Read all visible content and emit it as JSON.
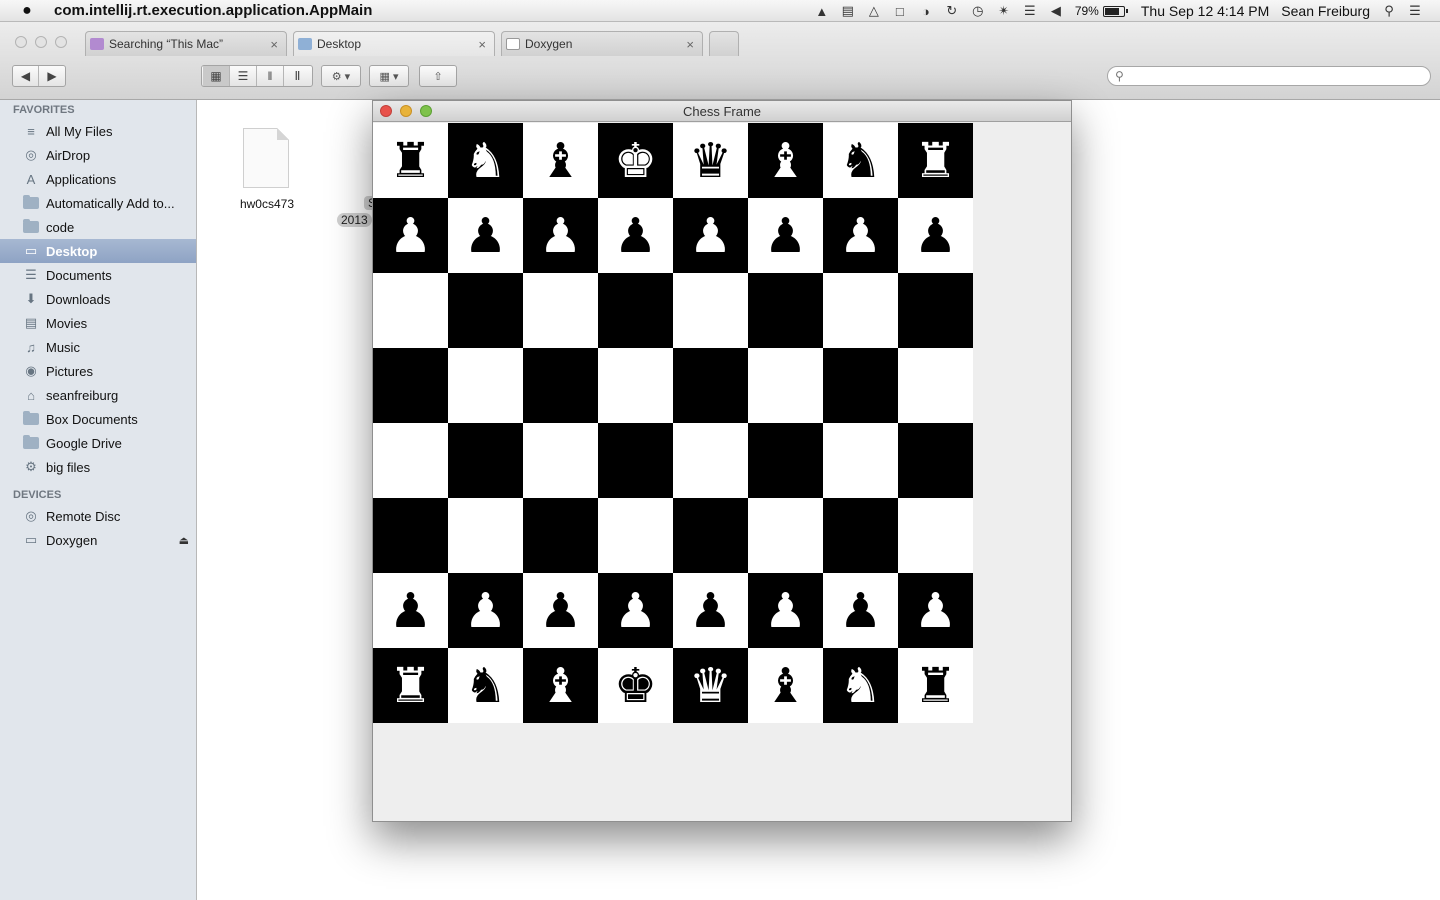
{
  "menubar": {
    "apple_icon": "apple-logo",
    "app_name": "com.intellij.rt.execution.application.AppMain",
    "status_icons": [
      "bowler-hat-icon",
      "scanner-icon",
      "drive-icon",
      "selection-icon",
      "cloud-icon",
      "sync-icon",
      "time-machine-icon",
      "bluetooth-icon",
      "wifi-icon",
      "volume-icon"
    ],
    "battery": "79%",
    "battery_level": 0.79,
    "clock": "Thu Sep 12  4:14 PM",
    "user": "Sean Freiburg",
    "search_icon": "spotlight-icon",
    "list_icon": "notification-center-icon"
  },
  "finder": {
    "tabs": [
      {
        "label": "Searching “This Mac”",
        "close": "×"
      },
      {
        "label": "Desktop",
        "close": "×"
      },
      {
        "label": "Doxygen",
        "close": "×"
      }
    ],
    "back": "◀",
    "forward": "▶",
    "view_modes": [
      "▦",
      "☰",
      "‖",
      "Ⅱ"
    ],
    "action": "⚙ ▾",
    "arrange": "▦ ▾",
    "share": "⇧",
    "search_placeholder": ""
  },
  "sidebar": {
    "favorites_header": "FAVORITES",
    "favorites": [
      {
        "label": "All My Files",
        "icon": "all-files-icon",
        "glyph": "≡"
      },
      {
        "label": "AirDrop",
        "icon": "airdrop-icon",
        "glyph": "◎"
      },
      {
        "label": "Applications",
        "icon": "applications-icon",
        "glyph": "A"
      },
      {
        "label": "Automatically Add to...",
        "icon": "folder-icon",
        "glyph": ""
      },
      {
        "label": "code",
        "icon": "folder-icon",
        "glyph": ""
      },
      {
        "label": "Desktop",
        "icon": "desktop-icon",
        "glyph": "▭"
      },
      {
        "label": "Documents",
        "icon": "documents-icon",
        "glyph": "☰"
      },
      {
        "label": "Downloads",
        "icon": "downloads-icon",
        "glyph": "⬇"
      },
      {
        "label": "Movies",
        "icon": "movies-icon",
        "glyph": "▤"
      },
      {
        "label": "Music",
        "icon": "music-icon",
        "glyph": "♫"
      },
      {
        "label": "Pictures",
        "icon": "pictures-icon",
        "glyph": "◉"
      },
      {
        "label": "seanfreiburg",
        "icon": "home-icon",
        "glyph": "⌂"
      },
      {
        "label": "Box Documents",
        "icon": "folder-icon",
        "glyph": ""
      },
      {
        "label": "Google Drive",
        "icon": "folder-icon",
        "glyph": ""
      },
      {
        "label": "big files",
        "icon": "gear-icon",
        "glyph": "⚙"
      }
    ],
    "devices_header": "DEVICES",
    "devices": [
      {
        "label": "Remote Disc",
        "icon": "remote-disc-icon",
        "glyph": "◎"
      },
      {
        "label": "Doxygen",
        "icon": "disk-image-icon",
        "glyph": "▭"
      }
    ],
    "eject": "⏏"
  },
  "desktop": {
    "file_label": "hw0cs473",
    "partial_labels": [
      "S",
      "2013"
    ]
  },
  "chess": {
    "title": "Chess Frame",
    "board": [
      [
        "♜",
        "♞",
        "♝",
        "♚",
        "♛",
        "♝",
        "♞",
        "♜"
      ],
      [
        "♟",
        "♟",
        "♟",
        "♟",
        "♟",
        "♟",
        "♟",
        "♟"
      ],
      [
        "",
        "",
        "",
        "",
        "",
        "",
        "",
        ""
      ],
      [
        "",
        "",
        "",
        "",
        "",
        "",
        "",
        ""
      ],
      [
        "",
        "",
        "",
        "",
        "",
        "",
        "",
        ""
      ],
      [
        "",
        "",
        "",
        "",
        "",
        "",
        "",
        ""
      ],
      [
        "♟",
        "♟",
        "♟",
        "♟",
        "♟",
        "♟",
        "♟",
        "♟"
      ],
      [
        "♜",
        "♞",
        "♝",
        "♚",
        "♛",
        "♝",
        "♞",
        "♜"
      ]
    ],
    "colors": {
      "light_square": "#ffffff",
      "dark_square": "#000000"
    }
  }
}
